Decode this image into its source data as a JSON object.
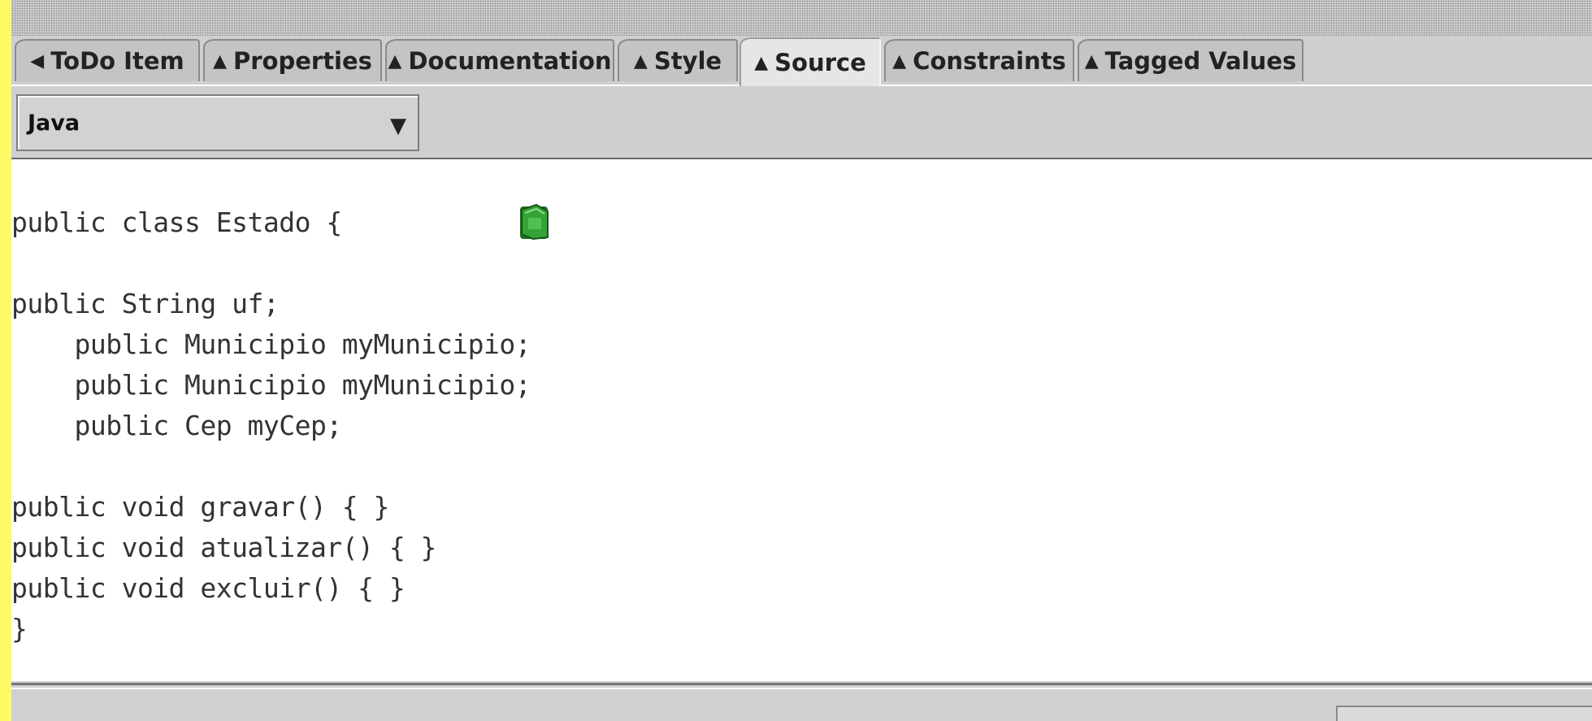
{
  "tabs": [
    {
      "label": "ToDo Item",
      "arrow": "◀"
    },
    {
      "label": "Properties",
      "arrow": "▲"
    },
    {
      "label": "Documentation",
      "arrow": "▲"
    },
    {
      "label": "Style",
      "arrow": "▲"
    },
    {
      "label": "Source",
      "arrow": "▲",
      "selected": true
    },
    {
      "label": "Constraints",
      "arrow": "▲"
    },
    {
      "label": "Tagged Values",
      "arrow": "▲"
    }
  ],
  "language_select": {
    "value": "Java",
    "icon": "chevron-down-icon"
  },
  "source": {
    "lines": [
      "public class Estado {",
      "",
      "public String uf;",
      "    public Municipio myMunicipio;",
      "    public Municipio myMunicipio;",
      "    public Cep myCep;",
      "",
      "public void gravar() { }",
      "public void atualizar() { }",
      "public void excluir() { }",
      "}"
    ]
  },
  "icons": {
    "folder": "folder-icon"
  },
  "colors": {
    "background_accent": "#fbfb66",
    "panel_gray": "#d0d0d0",
    "code_bg": "#ffffff",
    "folder_green": "#35a235"
  }
}
